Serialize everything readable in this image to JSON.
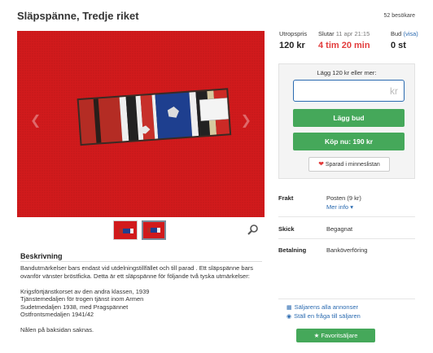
{
  "listing": {
    "title": "Släpspänne, Tredje riket",
    "visitors": "52 besökare"
  },
  "stats": {
    "price_label": "Utropspris",
    "price_value": "120 kr",
    "end_prefix": "Slutar",
    "end_date": "11 apr 21:15",
    "time_left": "4 tim 20 min",
    "bids_label": "Bud",
    "bids_link": "(visa)",
    "bids_value": "0 st"
  },
  "bid": {
    "label": "Lägg 120 kr eller mer:",
    "currency": "kr",
    "place_bid": "Lägg bud",
    "buy_now": "Köp nu: 190 kr",
    "save": "Sparad i minneslistan"
  },
  "info": {
    "shipping_label": "Frakt",
    "shipping_value": "Posten (9 kr)",
    "more_info": "Mer info",
    "condition_label": "Skick",
    "condition_value": "Begagnat",
    "payment_label": "Betalning",
    "payment_value": "Banköverföring"
  },
  "seller": {
    "all_listings": "Säljarens alla annonser",
    "ask_question": "Ställ en fråga till säljaren",
    "favorite": "Favoritsäljare"
  },
  "description": {
    "heading": "Beskrivning",
    "para1": "Bandutmärkelser bars endast vid utdelningstillfället och till parad . Ett släpspänne bars ovanför vänster bröstficka. Detta är ett släpspänne för följande två tyska utmärkelser:",
    "items": [
      "Krigsförtjänstkorset av den andra klassen, 1939",
      "Tjänstemedaljen för trogen tjänst inom Armen",
      "Sudetmedaljen 1938, med Pragspännet",
      "Ostfrontsmedaljen 1941/42"
    ],
    "para2": "Nålen på baksidan saknas."
  },
  "colors": {
    "accent_green": "#45a85a",
    "link_blue": "#2a6ab0",
    "alert_red": "#e23b3b",
    "photo_bg": "#d11a1c"
  }
}
